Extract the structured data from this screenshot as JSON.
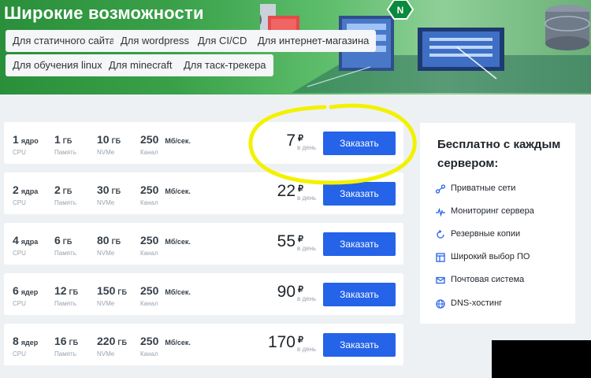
{
  "hero": {
    "title": "Широкие возможности",
    "tags": [
      "Для статичного сайта",
      "Для wordpress",
      "Для CI/CD",
      "Для интернет-магазина",
      "Для обучения linux",
      "Для minecraft",
      "Для таск-трекера"
    ]
  },
  "plans": [
    {
      "cpu": "1",
      "cpu_unit": "ядро",
      "ram": "1",
      "disk": "10",
      "channel": "250",
      "price": "7"
    },
    {
      "cpu": "2",
      "cpu_unit": "ядра",
      "ram": "2",
      "disk": "30",
      "channel": "250",
      "price": "22"
    },
    {
      "cpu": "4",
      "cpu_unit": "ядра",
      "ram": "6",
      "disk": "80",
      "channel": "250",
      "price": "55"
    },
    {
      "cpu": "6",
      "cpu_unit": "ядер",
      "ram": "12",
      "disk": "150",
      "channel": "250",
      "price": "90"
    },
    {
      "cpu": "8",
      "cpu_unit": "ядер",
      "ram": "16",
      "disk": "220",
      "channel": "250",
      "price": "170"
    }
  ],
  "labels": {
    "cpu": "CPU",
    "ram": "Память",
    "disk": "NVMe",
    "channel": "Канал",
    "ram_unit": "ГБ",
    "disk_unit": "ГБ",
    "channel_unit": "Мб/сек.",
    "currency": "₽",
    "per_day": "в день",
    "order": "Заказать"
  },
  "features": {
    "title": "Бесплатно с каждым сервером:",
    "items": [
      {
        "label": "Приватные сети",
        "icon": "network-icon"
      },
      {
        "label": "Мониторинг сервера",
        "icon": "pulse-icon"
      },
      {
        "label": "Резервные копии",
        "icon": "backup-icon"
      },
      {
        "label": "Широкий выбор ПО",
        "icon": "software-icon"
      },
      {
        "label": "Почтовая система",
        "icon": "mail-icon"
      },
      {
        "label": "DNS-хостинг",
        "icon": "globe-icon"
      }
    ]
  },
  "colors": {
    "accent": "#2563e8",
    "highlight": "#f2f200",
    "hero_green": "#3aa14a"
  }
}
